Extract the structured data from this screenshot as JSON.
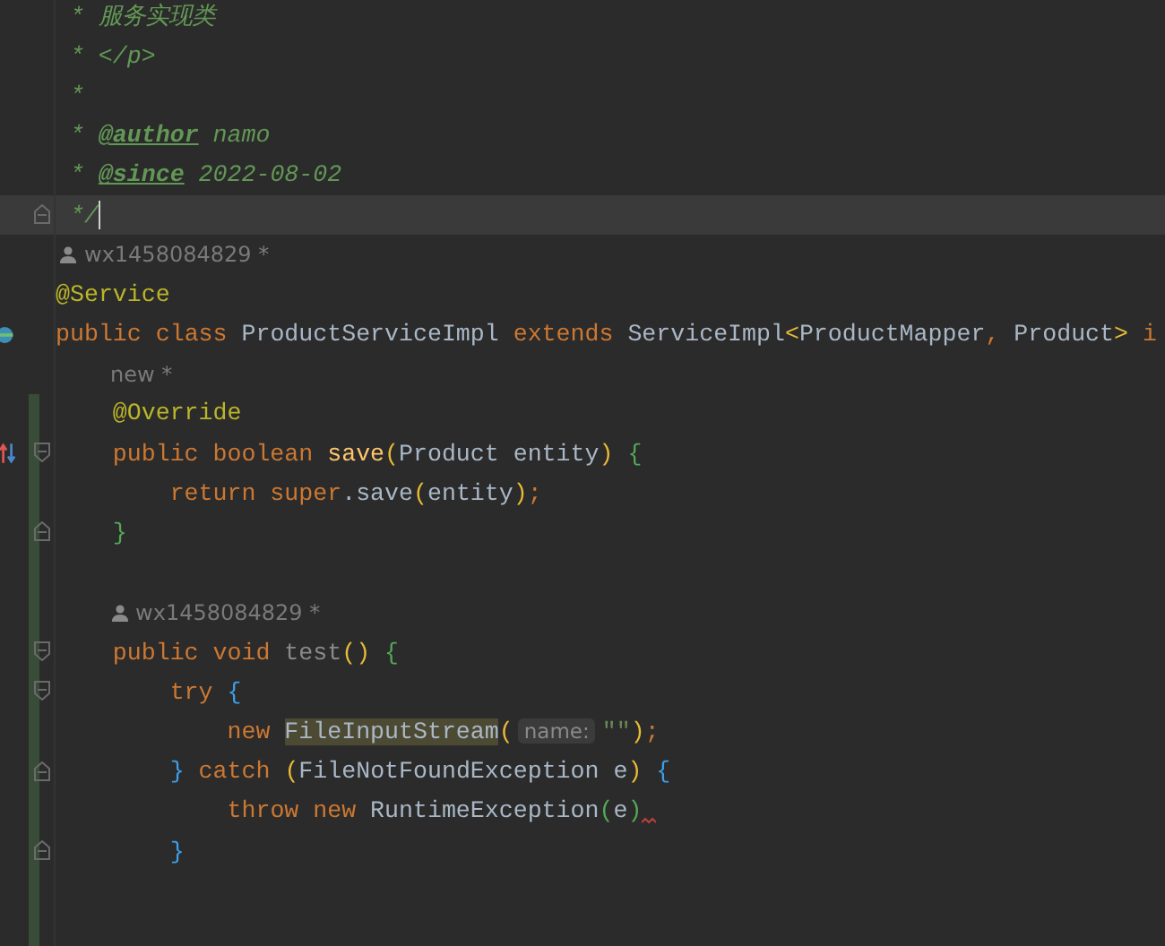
{
  "editor": {
    "lines": [
      {
        "kind": "doc",
        "changed": false,
        "tokens": [
          {
            "text": "* 服务实现类",
            "kind": "comment"
          }
        ]
      },
      {
        "kind": "doc",
        "changed": false,
        "tokens": [
          {
            "text": "* </p>",
            "kind": "comment"
          }
        ]
      },
      {
        "kind": "doc",
        "changed": false,
        "tokens": [
          {
            "text": "*",
            "kind": "comment"
          }
        ]
      },
      {
        "kind": "doc",
        "changed": false,
        "tokens": [
          {
            "text": "* ",
            "kind": "comment"
          },
          {
            "text": "@author",
            "kind": "doctag"
          },
          {
            "text": " namo",
            "kind": "comment"
          }
        ]
      },
      {
        "kind": "doc",
        "changed": false,
        "tokens": [
          {
            "text": "* ",
            "kind": "comment"
          },
          {
            "text": "@since",
            "kind": "doctag"
          },
          {
            "text": " 2022-08-02",
            "kind": "comment"
          }
        ]
      },
      {
        "kind": "doc",
        "changed": false,
        "current": true,
        "fold_end": true,
        "caret": true,
        "tokens": [
          {
            "text": "*/",
            "kind": "comment"
          }
        ]
      },
      {
        "kind": "hint",
        "changed": false,
        "person": true,
        "text": "wx1458084829 *"
      },
      {
        "kind": "code",
        "changed": false,
        "tokens": [
          {
            "text": "@Service",
            "kind": "ann"
          }
        ]
      },
      {
        "kind": "code",
        "changed": false,
        "implemented": true,
        "tokens": [
          {
            "text": "public class ",
            "kind": "kw"
          },
          {
            "text": "ProductServiceImpl ",
            "kind": "plain"
          },
          {
            "text": "extends ",
            "kind": "kw"
          },
          {
            "text": "ServiceImpl",
            "kind": "plain"
          },
          {
            "text": "<",
            "kind": "paren"
          },
          {
            "text": "ProductMapper",
            "kind": "plain"
          },
          {
            "text": ", ",
            "kind": "kw"
          },
          {
            "text": "Product",
            "kind": "plain"
          },
          {
            "text": "> ",
            "kind": "paren"
          },
          {
            "text": "i",
            "kind": "kw"
          }
        ],
        "children": [
          {
            "kind": "hint",
            "changed": false,
            "person": false,
            "text": "new *"
          },
          {
            "kind": "code",
            "changed": true,
            "tokens": [
              {
                "text": "@Override",
                "kind": "ann"
              }
            ]
          },
          {
            "kind": "code",
            "changed": true,
            "fold_start": true,
            "overrides": true,
            "tokens": [
              {
                "text": "public boolean ",
                "kind": "kw"
              },
              {
                "text": "save",
                "kind": "fn"
              },
              {
                "text": "(",
                "kind": "paren"
              },
              {
                "text": "Product entity",
                "kind": "plain"
              },
              {
                "text": ") ",
                "kind": "paren"
              },
              {
                "text": "{",
                "kind": "green"
              }
            ],
            "children": [
              {
                "kind": "code",
                "changed": true,
                "tokens": [
                  {
                    "text": "return super",
                    "kind": "kw"
                  },
                  {
                    "text": ".save",
                    "kind": "plain"
                  },
                  {
                    "text": "(",
                    "kind": "paren"
                  },
                  {
                    "text": "entity",
                    "kind": "plain"
                  },
                  {
                    "text": ")",
                    "kind": "paren"
                  },
                  {
                    "text": ";",
                    "kind": "kw"
                  }
                ]
              }
            ]
          },
          {
            "kind": "code",
            "changed": true,
            "fold_end": true,
            "tokens": [
              {
                "text": "}",
                "kind": "green"
              }
            ]
          },
          {
            "kind": "blank",
            "changed": true
          },
          {
            "kind": "hint",
            "changed": true,
            "person": true,
            "text": "wx1458084829 *"
          },
          {
            "kind": "code",
            "changed": true,
            "fold_start": true,
            "tokens": [
              {
                "text": "public void ",
                "kind": "kw"
              },
              {
                "text": "test",
                "kind": "unused"
              },
              {
                "text": "() ",
                "kind": "paren"
              },
              {
                "text": "{",
                "kind": "green"
              }
            ],
            "children": [
              {
                "kind": "code",
                "changed": true,
                "fold_start": true,
                "tokens": [
                  {
                    "text": "try ",
                    "kind": "kw"
                  },
                  {
                    "text": "{",
                    "kind": "blue"
                  }
                ],
                "children": [
                  {
                    "kind": "code",
                    "changed": true,
                    "tokens": [
                      {
                        "text": "new ",
                        "kind": "kw"
                      },
                      {
                        "text": "FileInputStream",
                        "kind": "hl"
                      },
                      {
                        "text": "(",
                        "kind": "paren"
                      },
                      {
                        "text": "name:",
                        "kind": "inlay"
                      },
                      {
                        "text": "\"\"",
                        "kind": "str"
                      },
                      {
                        "text": ")",
                        "kind": "paren"
                      },
                      {
                        "text": ";",
                        "kind": "kw"
                      }
                    ]
                  }
                ]
              },
              {
                "kind": "code",
                "changed": true,
                "fold_end": true,
                "tokens": [
                  {
                    "text": "} ",
                    "kind": "blue"
                  },
                  {
                    "text": "catch ",
                    "kind": "kw"
                  },
                  {
                    "text": "(",
                    "kind": "paren"
                  },
                  {
                    "text": "FileNotFoundException e",
                    "kind": "plain"
                  },
                  {
                    "text": ") ",
                    "kind": "paren"
                  },
                  {
                    "text": "{",
                    "kind": "blue"
                  }
                ],
                "children": [
                  {
                    "kind": "code",
                    "changed": true,
                    "tokens": [
                      {
                        "text": "throw new ",
                        "kind": "kw"
                      },
                      {
                        "text": "RuntimeException",
                        "kind": "plain"
                      },
                      {
                        "text": "(",
                        "kind": "green"
                      },
                      {
                        "text": "e",
                        "kind": "plain"
                      },
                      {
                        "text": ")",
                        "kind": "green"
                      },
                      {
                        "kind": "squiggle"
                      }
                    ]
                  }
                ]
              },
              {
                "kind": "code",
                "changed": true,
                "fold_end": true,
                "tokens": [
                  {
                    "text": "}",
                    "kind": "blue"
                  }
                ]
              }
            ]
          },
          {
            "kind": "blank",
            "changed": true
          },
          {
            "kind": "blank",
            "changed": true
          }
        ]
      }
    ]
  }
}
